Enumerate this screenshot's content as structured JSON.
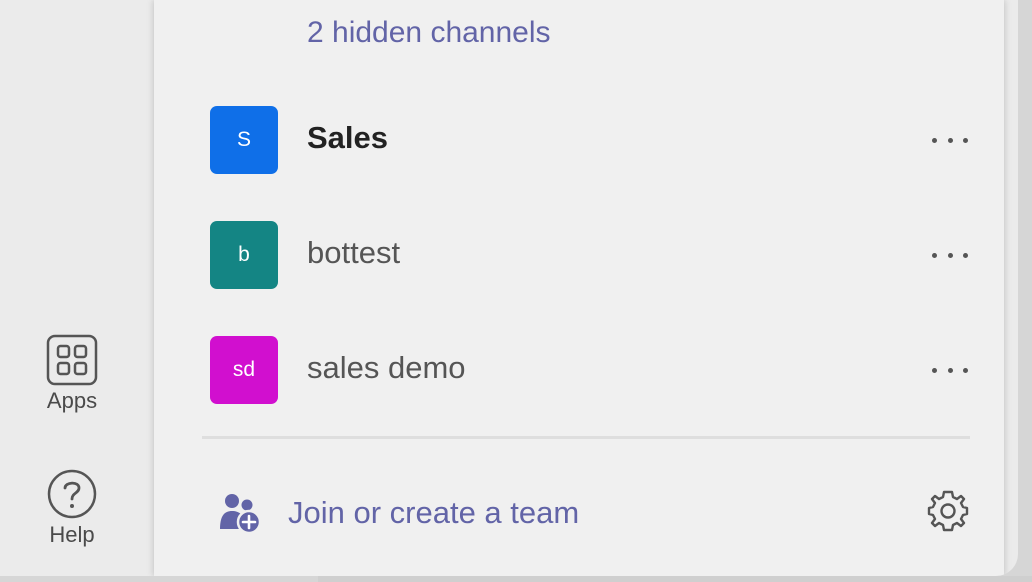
{
  "rail": {
    "apps_label": "Apps",
    "help_label": "Help"
  },
  "teams_panel": {
    "hidden_channels": "2 hidden channels",
    "teams": [
      {
        "initials": "S",
        "name": "Sales",
        "color": "#0f6fe8",
        "active": true
      },
      {
        "initials": "b",
        "name": "bottest",
        "color": "#148584",
        "active": false
      },
      {
        "initials": "sd",
        "name": "sales demo",
        "color": "#d10fcf",
        "active": false
      }
    ],
    "join_label": "Join or create a team"
  },
  "icons": {
    "apps": "apps-grid-icon",
    "help": "help-icon",
    "more": "more-options-icon",
    "join": "join-team-icon",
    "settings": "gear-icon"
  },
  "colors": {
    "accent": "#6264a7"
  }
}
